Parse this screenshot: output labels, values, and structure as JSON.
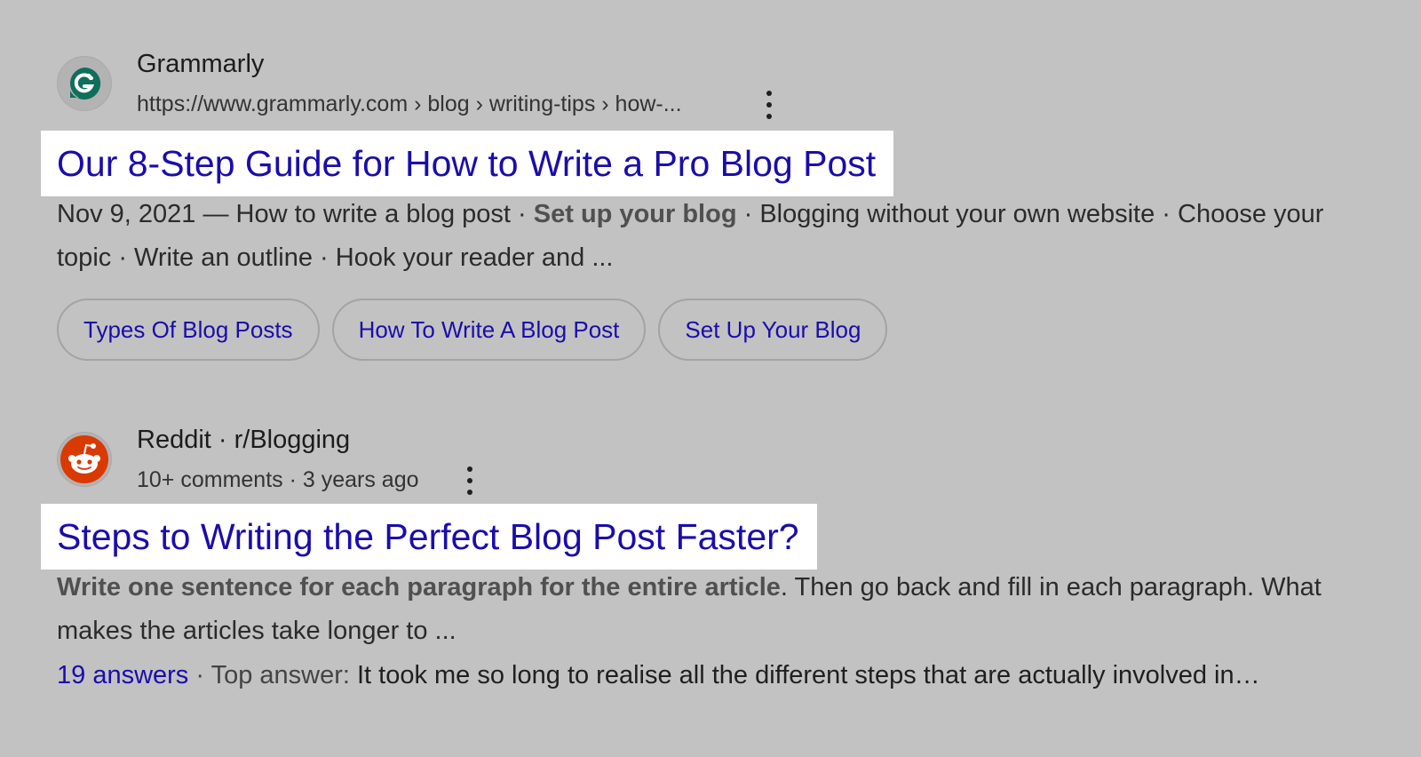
{
  "results": [
    {
      "site_name": "Grammarly",
      "url": "https://www.grammarly.com › blog › writing-tips › how-...",
      "title": "Our 8-Step Guide for How to Write a Pro Blog Post",
      "snippet_before": "Nov 9, 2021 — How to write a blog post · ",
      "snippet_bold": "Set up your blog",
      "snippet_after": " · Blogging without your own website · Choose your topic · Write an outline · Hook your reader and ...",
      "chips": [
        "Types Of Blog Posts",
        "How To Write A Blog Post",
        "Set Up Your Blog"
      ],
      "logo_color": "#0f6e5c"
    },
    {
      "site_name": "Reddit · r/Blogging",
      "meta": "10+ comments · 3 years ago",
      "title": "Steps to Writing the Perfect Blog Post Faster?",
      "snippet_bold": "Write one sentence for each paragraph for the entire article",
      "snippet_after": ". Then go back and fill in each paragraph. What makes the articles take longer to ...",
      "answers_count": "19 answers",
      "answers_sep": " · ",
      "answers_label": "Top answer: ",
      "answers_text": "It took me so long to realise all the different steps that are actually involved in…",
      "logo_color": "#d93a00"
    }
  ],
  "colors": {
    "background": "#c2c2c2",
    "link": "#1a0dab",
    "highlight": "#ffffff"
  }
}
